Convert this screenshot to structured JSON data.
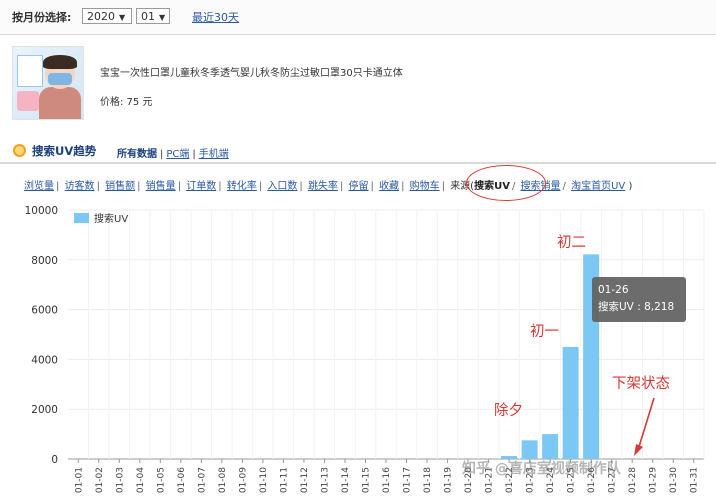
{
  "filter": {
    "month_label": "按月份选择:",
    "year": "2020",
    "month": "01",
    "recent_link": "最近30天"
  },
  "product": {
    "title": "宝宝一次性口罩儿童秋冬季透气婴儿秋冬防尘过敏口罩30只卡通立体",
    "price": "价格: 75 元"
  },
  "section": {
    "title": "搜索UV趋势",
    "tabs": [
      "所有数据",
      "PC端",
      "手机端"
    ]
  },
  "metrics": {
    "items": [
      "浏览量",
      "访客数",
      "销售额",
      "销售量",
      "订单数",
      "转化率",
      "入口数",
      "跳失率",
      "停留",
      "收藏",
      "购物车"
    ],
    "source_prefix": "来源(",
    "source_current": "搜索UV",
    "source_others": [
      "搜索销量",
      "淘宝首页UV"
    ],
    "source_suffix": ")"
  },
  "chart_data": {
    "type": "bar",
    "legend": [
      "搜索UV"
    ],
    "y_ticks": [
      "0",
      "2000",
      "4000",
      "6000",
      "8000",
      "10000"
    ],
    "ylim": [
      0,
      10000
    ],
    "categories": [
      "01-01",
      "01-02",
      "01-03",
      "01-04",
      "01-05",
      "01-06",
      "01-07",
      "01-08",
      "01-09",
      "01-10",
      "01-11",
      "01-12",
      "01-13",
      "01-14",
      "01-15",
      "01-16",
      "01-17",
      "01-18",
      "01-19",
      "01-20",
      "01-21",
      "01-22",
      "01-23",
      "01-24",
      "01-25",
      "01-26",
      "01-27",
      "01-28",
      "01-29",
      "01-30",
      "01-31"
    ],
    "series": [
      {
        "name": "搜索UV",
        "values": [
          0,
          0,
          0,
          0,
          0,
          0,
          0,
          0,
          0,
          0,
          0,
          0,
          0,
          0,
          0,
          0,
          0,
          0,
          0,
          0,
          0,
          120,
          750,
          1000,
          4500,
          8218,
          0,
          0,
          0,
          0,
          0
        ]
      }
    ],
    "grid": true,
    "legend_position": "top-left",
    "tooltip": {
      "date": "01-26",
      "text": "搜索UV : 8,218"
    }
  },
  "annotations": {
    "chuxi": "除夕",
    "chuyi": "初一",
    "chuer": "初二",
    "offshelf": "下架状态",
    "watermark": "知乎 @喜店室视频制作队"
  },
  "colors": {
    "bar": "#7cc8f4",
    "accent": "#2a59a5",
    "annotation": "#d63a32"
  }
}
